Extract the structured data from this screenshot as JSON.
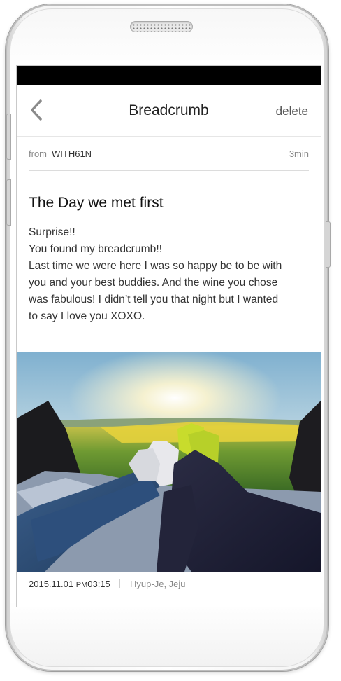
{
  "header": {
    "title": "Breadcrumb",
    "delete_label": "delete",
    "back_icon": "chevron-left-icon"
  },
  "meta": {
    "from_label": "from",
    "sender": "WITH61N",
    "time_ago": "3min"
  },
  "post": {
    "title": "The Day we met first",
    "lines": [
      "Surprise!!",
      "You found my breadcrumb!!",
      "Last time we were here I was so happy be to be with",
      "you and your best buddies. And the wine you chose",
      "was fabulous! I didn’t tell you that night but I wanted",
      "to say I love you XOXO."
    ]
  },
  "footer": {
    "date": "2015.11.01",
    "ampm": "PM",
    "clock": "03:15",
    "location": "Hyup-Je, Jeju"
  },
  "colors": {
    "status_bar": "#000000",
    "text_primary": "#222222",
    "text_secondary": "#888888"
  }
}
